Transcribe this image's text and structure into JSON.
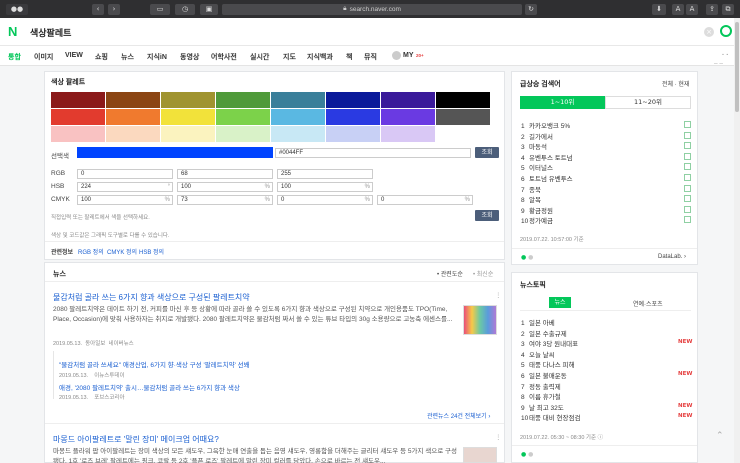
{
  "browser": {
    "url": "search.naver.com",
    "zoom_small": "A",
    "zoom_large": "A"
  },
  "header": {
    "query": "색상팔레트"
  },
  "nav": {
    "tabs": [
      "통합",
      "이미지",
      "VIEW",
      "쇼핑",
      "뉴스",
      "지식iN",
      "동영상",
      "어학사전",
      "실시간",
      "지도",
      "지식백과",
      "책",
      "뮤직"
    ],
    "my": "MY",
    "my_badge": "20+"
  },
  "palette": {
    "title": "색상 팔레트",
    "colors_row1": [
      "#8b1a1a",
      "#8b4513",
      "#a09430",
      "#4f9a3a",
      "#3a7f9a",
      "#0a1a9a",
      "#3a1a9a",
      "#000000"
    ],
    "colors_row2": [
      "#e23b2e",
      "#f07a2e",
      "#f2e23a",
      "#7cd24a",
      "#5ab8e2",
      "#2a3ae2",
      "#6a3ae2",
      "#555555"
    ],
    "colors_row3": [
      "#f9c2c2",
      "#fbd9bf",
      "#fbf3bf",
      "#d9f2c8",
      "#c8e8f5",
      "#c8d0f5",
      "#d9c8f5",
      "#ffffff"
    ],
    "selected_label": "선택색",
    "selected_color": "#0044FF",
    "selected_hex": "#0044FF",
    "lookup_btn": "조회",
    "rgb_label": "RGB",
    "rgb": [
      "0",
      "68",
      "255"
    ],
    "hsb_label": "HSB",
    "hsb": [
      "224",
      "100",
      "100"
    ],
    "hsb_units": [
      "°",
      "%",
      "%"
    ],
    "cmyk_label": "CMYK",
    "cmyk": [
      "100",
      "73",
      "0",
      "0"
    ],
    "pct": "%",
    "hint": "직접입력 또는 팔레트에서 색을 선택하세요.",
    "lookup_btn2": "조회",
    "note": "색상 및 코드값은 그래픽 도구별로 다를 수 있습니다.",
    "related_label": "관련정보",
    "related_links": [
      "RGB 정의",
      "CMYK 정의",
      "HSB 정의"
    ]
  },
  "news": {
    "title": "뉴스",
    "filter1": "관련도순",
    "filter2": "최신순",
    "articles": [
      {
        "headline": "물감처럼 골라 쓰는 6가지 향과 색상으로 구성된 팔레트치약",
        "body": "2080 팔레트치약은 데이트 하기 전, 커피를 마신 후 등 상황에 따라 골라 쓸 수 있도록 6가지 향과 색상으로 구성된 치약으로 개인용품도 TPO(Time, Place, Occasion)에 맞춰 사용하자는 취지로 개발됐다. 2080 팔레트치약은 물감처럼 짜서 쓸 수 있는 튜브 타입의 30g 소용량으로 고농축 에센스를...",
        "date": "2019.05.13.",
        "press": "동아일보",
        "source": "네이버뉴스"
      }
    ],
    "related": [
      {
        "headline": "\"물감처럼 골라 쓰세요\" 애경산업, 6가지 향·색상 구성 '팔레트치약' 선봬",
        "date": "2019.05.13.",
        "press": "이뉴스투데이"
      },
      {
        "headline": "애경, '2080 팔레트치약' 출시…물감처럼 골라 쓰는 6가지 향과 색상",
        "date": "2019.05.13.",
        "press": "포브스코리아"
      }
    ],
    "related_more": "관련뉴스 24건 전체보기",
    "article2_headline": "마몽드 아이팔레트로 '말린 장미' 메이크업 어때요?",
    "article2_body": "마몽드 플라워 팝 아이팔레트는 장미 색상의 모든 섀도우, 그윽한 눈매 연출을 돕는 음영 섀도우, 영롱함을 더해주는 글리터 섀도우 등 5가지 색으로 구성됐다. 1호 '로즈 브레' 팔레트에는 핑크, 코랄 등 2호 '플픈 로즈' 팔레트에 말린 장미 컬러를 담았다. 손으로 바르는 전 섀도우..."
  },
  "trending": {
    "title": "급상승 검색어",
    "toggle": "전체 · 현재",
    "tab1": "1~10위",
    "tab2": "11~20위",
    "items": [
      "카카오뱅크 5%",
      "길가에서",
      "마동석",
      "유벤투스 토트넘",
      "이터널스",
      "토트넘 유벤투스",
      "종북",
      "알목",
      "황금정원",
      "정가예금"
    ],
    "time": "2019.07.22. 10:57:00 기준",
    "provider": "DataLab."
  },
  "newstopic": {
    "title": "뉴스토픽",
    "tab1": "뉴스",
    "tab2": "연예·스포츠",
    "items": [
      "일본 아베",
      "일본 수출규제",
      "여야 3당 원내대표",
      "오늘 날씨",
      "태풍 다나스 피해",
      "일본 불매운동",
      "정동 출력제",
      "이름 휴가철",
      "날 최고 32도",
      "태풍 대비 현장점검"
    ],
    "new_flags": [
      false,
      false,
      true,
      false,
      false,
      true,
      false,
      false,
      true,
      true
    ],
    "new_label": "NEW",
    "time": "2019.07.22. 05:30 ~ 08:30 기준"
  },
  "colors": {
    "naver_green": "#03c75a",
    "link_blue": "#1a5fd1"
  }
}
